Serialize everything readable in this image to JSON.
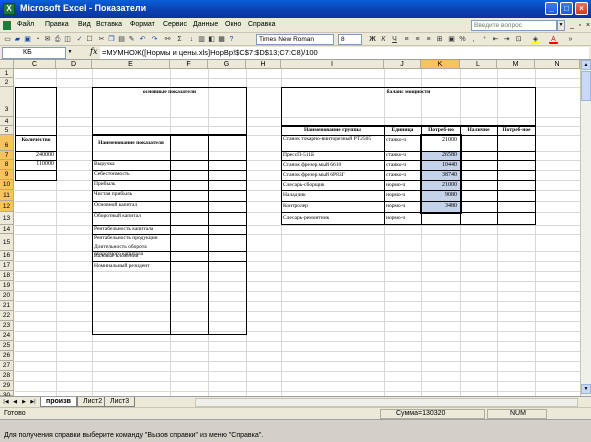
{
  "window": {
    "title": "Microsoft Excel - Показатели",
    "app_icon": "X"
  },
  "menu": {
    "items": [
      "Файл",
      "Правка",
      "Вид",
      "Вставка",
      "Формат",
      "Сервис",
      "Данные",
      "Окно",
      "Справка"
    ],
    "help_placeholder": "Введите вопрос"
  },
  "toolbar": {
    "font_name": "Times New Roman",
    "font_size": "8",
    "bold": "Ж",
    "italic": "К",
    "underline": "Ч",
    "percent": "%",
    "sum": "Σ",
    "fill_color": "#ffff00",
    "font_color": "#ff0000"
  },
  "formula_bar": {
    "name_box": "КБ",
    "fx": "fx",
    "formula": "=МУМНОЖ([Нормы и цены.xls]НорВр!$C$7:$D$13;C7:C8)/100"
  },
  "columns": [
    "C",
    "D",
    "E",
    "F",
    "G",
    "H",
    "I",
    "J",
    "K",
    "L",
    "M",
    "N"
  ],
  "selected_column": "K",
  "rows": [
    "1",
    "2",
    "3",
    "4",
    "5",
    "6",
    "7",
    "8",
    "9",
    "10",
    "11",
    "12",
    "13",
    "14",
    "15",
    "16",
    "17",
    "18",
    "19",
    "20",
    "21",
    "22",
    "23",
    "24",
    "25",
    "26",
    "27",
    "28",
    "29",
    "30"
  ],
  "selected_rows": [
    "6",
    "7",
    "8",
    "9",
    "10",
    "11",
    "12"
  ],
  "sheet": {
    "col_c": {
      "header": "Количество",
      "values": [
        "240000",
        "110000"
      ]
    },
    "main_indicators": {
      "title": "основные показатели",
      "header": "Наименование показателя",
      "items": [
        "Выручка",
        "Себестоимость",
        "Прибыль",
        "Чистая прибыль",
        "Основной капитал",
        "Оборотный капитал",
        "Рентабельность капитала",
        "Рентабельность продукции",
        "Длительность оборота оборотного капитала",
        "Валовые вложения",
        "Номинальный резидент"
      ]
    },
    "capacity": {
      "title": "баланс мощности",
      "headers": [
        "Наименование группы",
        "Единица",
        "Потреб-но",
        "Наличие",
        "Потреб-ное"
      ],
      "rows": [
        {
          "name": "Станок токарно-винторезный РТ2505",
          "unit": "станко-ч",
          "need": "21000"
        },
        {
          "name": "ПрессП-511Б",
          "unit": "станко-ч",
          "need": "26580"
        },
        {
          "name": "Станок фрезер.мый 6610",
          "unit": "станко-ч",
          "need": "10440"
        },
        {
          "name": "Станок фрезер.мый 6Р83Г",
          "unit": "станко-ч",
          "need": "38740"
        },
        {
          "name": "Слесарь-сборщик",
          "unit": "нормо-ч",
          "need": "21000"
        },
        {
          "name": "Наладчик",
          "unit": "нормо-ч",
          "need": "9080"
        },
        {
          "name": "Контролер",
          "unit": "нормо-ч",
          "need": "3480"
        },
        {
          "name": "Слесарь-ремонтник",
          "unit": "нормо-ч",
          "need": ""
        }
      ]
    }
  },
  "tabs": [
    "произв",
    "Лист2",
    "Лист3"
  ],
  "active_tab": "произв",
  "status": {
    "ready": "Готово",
    "sum": "Сумма=130320",
    "num": "NUM"
  },
  "help_line": "Для получения справки выберите команду \"Вызов справки\" из меню \"Справка\"."
}
